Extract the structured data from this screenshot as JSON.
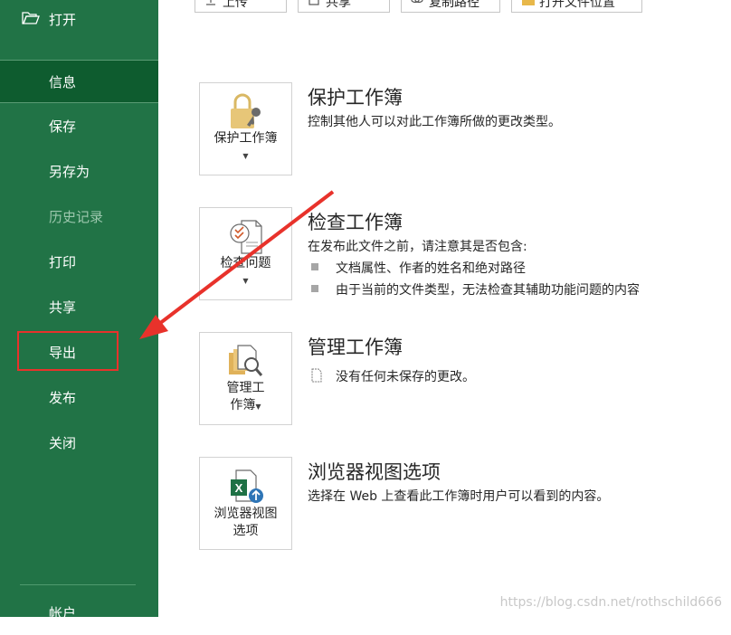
{
  "sidebar": {
    "open_label": "打开",
    "items": [
      {
        "label": "信息"
      },
      {
        "label": "保存"
      },
      {
        "label": "另存为"
      },
      {
        "label": "历史记录"
      },
      {
        "label": "打印"
      },
      {
        "label": "共享"
      },
      {
        "label": "导出"
      },
      {
        "label": "发布"
      },
      {
        "label": "关闭"
      }
    ],
    "account_label": "帐户"
  },
  "top_buttons": [
    {
      "label": "上传"
    },
    {
      "label": "共享"
    },
    {
      "label": "复制路径"
    },
    {
      "label": "打开文件位置"
    }
  ],
  "sections": {
    "protect": {
      "tile_label": "保护工作簿",
      "title": "保护工作簿",
      "desc": "控制其他人可以对此工作簿所做的更改类型。"
    },
    "inspect": {
      "tile_label": "检查问题",
      "title": "检查工作簿",
      "desc": "在发布此文件之前，请注意其是否包含:",
      "bullets": [
        "文档属性、作者的姓名和绝对路径",
        "由于当前的文件类型，无法检查其辅助功能问题的内容"
      ]
    },
    "manage": {
      "tile_label_line1": "管理工",
      "tile_label_line2": "作簿",
      "title": "管理工作簿",
      "note": "没有任何未保存的更改。"
    },
    "browser": {
      "tile_label_line1": "浏览器视图",
      "tile_label_line2": "选项",
      "title": "浏览器视图选项",
      "desc": "选择在 Web 上查看此工作簿时用户可以看到的内容。"
    }
  },
  "watermark": "https://blog.csdn.net/rothschild666",
  "colors": {
    "sidebar": "#217346",
    "active": "#0e5c2f",
    "annotation": "#e8322b"
  }
}
